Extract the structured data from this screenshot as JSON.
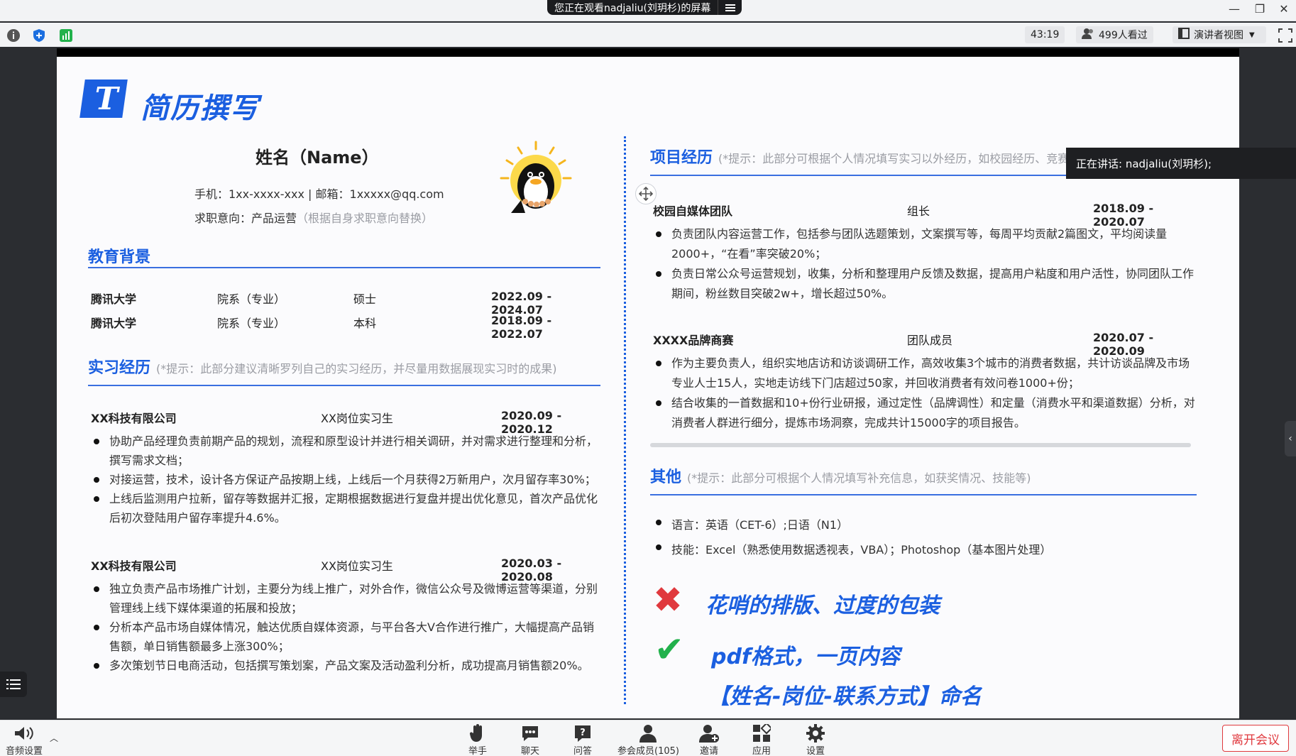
{
  "window": {
    "share_banner": "您正在观看nadjaliu(刘玥杉)的屏幕",
    "share_menu_icon": "menu-icon",
    "minimize": "—",
    "restore": "❐",
    "close": "✕"
  },
  "toolbar": {
    "timer": "43:19",
    "viewers": "499人看过",
    "view_mode": "演讲者视图",
    "icons": [
      "info-icon",
      "shield-icon",
      "signal-icon",
      "user-icon",
      "layout-icon",
      "fullscreen-icon"
    ]
  },
  "speaker": {
    "label": "正在讲话: nadjaliu(刘玥杉);"
  },
  "slide": {
    "title": "简历撰写",
    "logo_letter": "T",
    "name": "姓名（Name）",
    "contact": "手机：1xx-xxxx-xxx | 邮箱：1xxxxx@qq.com",
    "intent_label": "求职意向：产品运营",
    "intent_hint": "（根据自身求职意向替换）",
    "education": {
      "title": "教育背景",
      "rows": [
        {
          "school": "腾讯大学",
          "dept": "院系（专业）",
          "degree": "硕士",
          "period": "2022.09 - 2024.07"
        },
        {
          "school": "腾讯大学",
          "dept": "院系（专业）",
          "degree": "本科",
          "period": "2018.09 - 2022.07"
        }
      ]
    },
    "internship": {
      "title": "实习经历",
      "hint": "(*提示：此部分建议清晰罗列自己的实习经历，并尽量用数据展现实习时的成果)",
      "jobs": [
        {
          "company": "XX科技有限公司",
          "role": "XX岗位实习生",
          "period": "2020.09 - 2020.12",
          "bullets": [
            "协助产品经理负责前期产品的规划，流程和原型设计并进行相关调研，并对需求进行整理和分析，撰写需求文档；",
            "对接运营，技术，设计各方保证产品按期上线，上线后一个月获得2万新用户，次月留存率30%；",
            "上线后监测用户拉新，留存等数据并汇报，定期根据数据进行复盘并提出优化意见，首次产品优化后初次登陆用户留存率提升4.6%。"
          ]
        },
        {
          "company": "XX科技有限公司",
          "role": "XX岗位实习生",
          "period": "2020.03 - 2020.08",
          "bullets": [
            "独立负责产品市场推广计划，主要分为线上推广，对外合作，微信公众号及微博运营等渠道，分别管理线上线下媒体渠道的拓展和投放；",
            "分析本产品市场自媒体情况，触达优质自媒体资源，与平台各大V合作进行推广，大幅提高产品销售额，单日销售额最多上涨300%；",
            "多次策划节日电商活动，包括撰写策划案，产品文案及活动盈利分析，成功提高月销售额20%。"
          ]
        }
      ]
    },
    "projects": {
      "title": "项目经历",
      "hint": "(*提示：此部分可根据个人情况填写实习以外经历，如校园经历、竞赛经历等)",
      "items": [
        {
          "name": "校园自媒体团队",
          "role": "组长",
          "period": "2018.09 - 2020.07",
          "bullets": [
            "负责团队内容运营工作，包括参与团队选题策划，文案撰写等，每周平均贡献2篇图文，平均阅读量2000+，“在看”率突破20%；",
            "负责日常公众号运营规划，收集，分析和整理用户反馈及数据，提高用户粘度和用户活性，协同团队工作期间，粉丝数目突破2w+，增长超过50%。"
          ]
        },
        {
          "name": "XXXX品牌商赛",
          "role": "团队成员",
          "period": "2020.07 - 2020.09",
          "bullets": [
            "作为主要负责人，组织实地店访和访谈调研工作，高效收集3个城市的消费者数据，共计访谈品牌及市场专业人士15人，实地走访线下门店超过50家，并回收消费者有效问卷1000+份；",
            "结合收集的一首数据和10+份行业研报，通过定性（品牌调性）和定量（消费水平和渠道数据）分析，对消费者人群进行细分，提炼市场洞察，完成共计15000字的项目报告。"
          ]
        }
      ]
    },
    "other": {
      "title": "其他",
      "hint": "(*提示：此部分可根据个人情况填写补充信息，如获奖情况、技能等)",
      "bullets": [
        "语言：英语（CET-6）;日语（N1）",
        "技能：Excel（熟悉使用数据透视表，VBA）；Photoshop（基本图片处理）"
      ]
    },
    "callouts": {
      "bad_mark": "✖",
      "bad": "花哨的排版、过度的包装",
      "good_mark": "✔",
      "good": "pdf格式，一页内容",
      "naming": "【姓名-岗位-联系方式】命名"
    }
  },
  "bottombar": {
    "audio": "音频设置",
    "items": [
      {
        "label": "举手",
        "icon": "hand-icon"
      },
      {
        "label": "聊天",
        "icon": "chat-icon"
      },
      {
        "label": "问答",
        "icon": "qa-icon"
      },
      {
        "label": "参会成员(105)",
        "icon": "members-icon"
      },
      {
        "label": "邀请",
        "icon": "invite-icon"
      },
      {
        "label": "应用",
        "icon": "apps-icon"
      },
      {
        "label": "设置",
        "icon": "settings-icon"
      }
    ],
    "leave": "离开会议"
  },
  "colors": {
    "accent": "#1b5fe0",
    "danger": "#e0393e",
    "success": "#22b14c"
  }
}
